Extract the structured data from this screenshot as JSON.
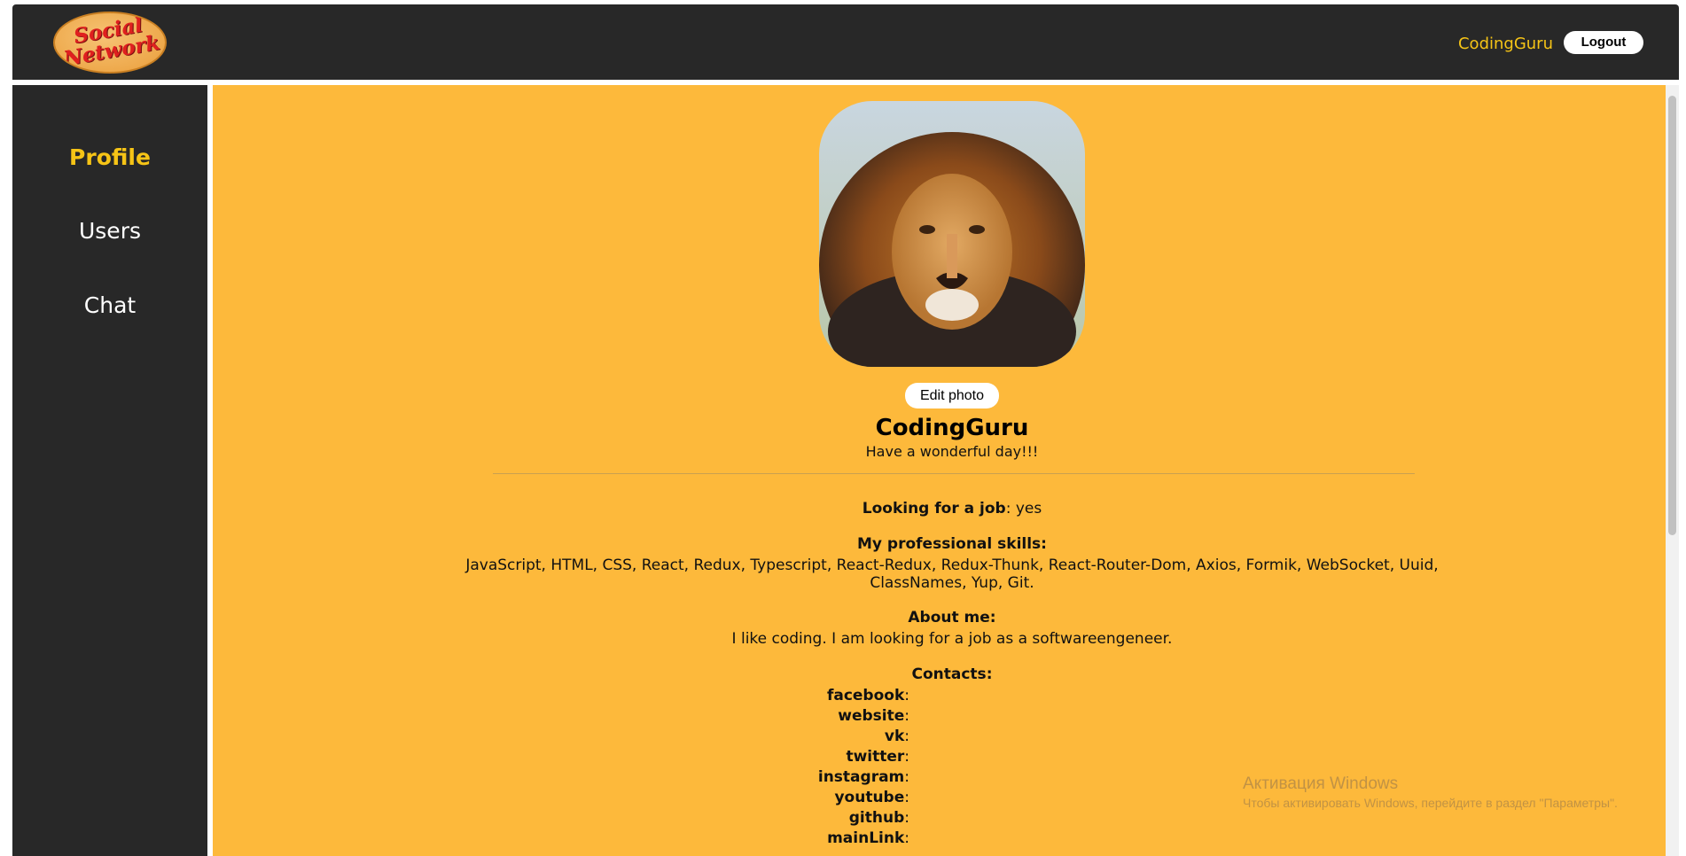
{
  "header": {
    "logo_text_line1": "Social",
    "logo_text_line2": "Network",
    "user_name": "CodingGuru",
    "logout_label": "Logout"
  },
  "sidebar": {
    "items": [
      {
        "label": "Profile",
        "active": true
      },
      {
        "label": "Users",
        "active": false
      },
      {
        "label": "Chat",
        "active": false
      }
    ]
  },
  "profile": {
    "edit_photo_label": "Edit photo",
    "name": "CodingGuru",
    "status": "Have a wonderful day!!!",
    "looking_for_job_label": "Looking for a job",
    "looking_for_job_value": ": yes",
    "skills_label": "My professional skills",
    "skills_value_line1": "JavaScript, HTML, CSS, React, Redux, Typescript, React-Redux, Redux-Thunk, React-Router-Dom, Axios, Formik, WebSocket, Uuid,",
    "skills_value_line2": "ClassNames, Yup, Git.",
    "about_label": "About me",
    "about_value": "I like coding. I am looking for a job as a softwareengeneer.",
    "contacts_label": "Contacts",
    "contacts": [
      "facebook",
      "website",
      "vk",
      "twitter",
      "instagram",
      "youtube",
      "github",
      "mainLink"
    ]
  },
  "watermark": {
    "title": "Активация Windows",
    "subtitle": "Чтобы активировать Windows, перейдите в раздел \"Параметры\"."
  },
  "colors": {
    "accent": "#f6c416",
    "main_bg": "#fdb93b",
    "dark_bg": "#282828"
  }
}
